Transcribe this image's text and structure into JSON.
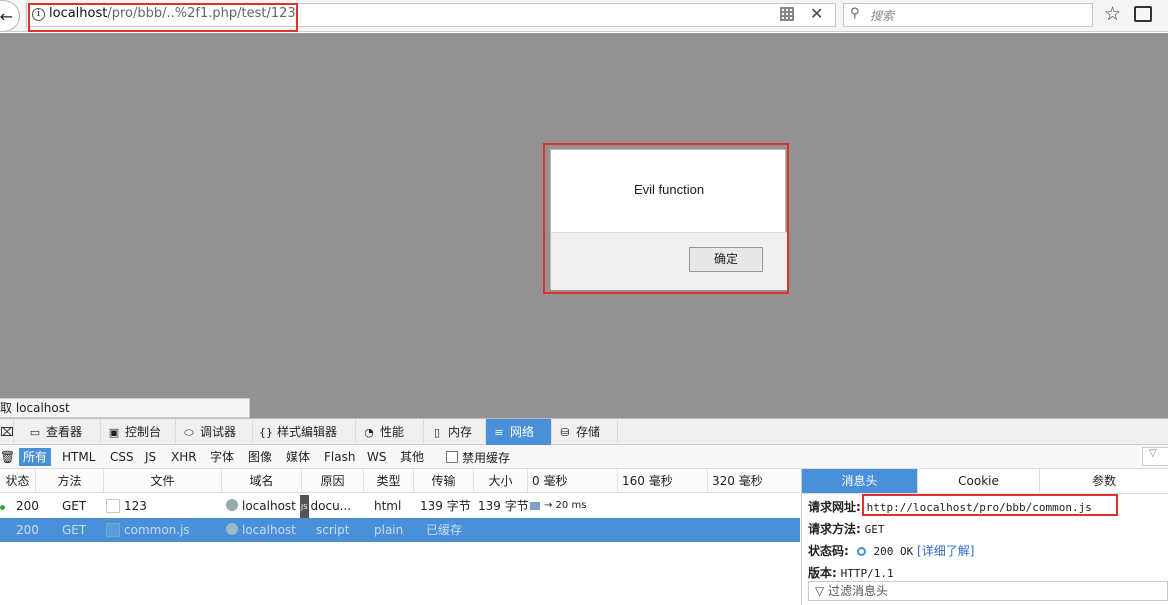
{
  "toolbar": {
    "url_host": "localhost",
    "url_path": "/pro/bbb/..%2f1.php/test/123",
    "search_placeholder": "搜索"
  },
  "dialog": {
    "message": "Evil function",
    "ok_label": "确定"
  },
  "status_tip": "取 localhost",
  "devtools": {
    "tabs": [
      "查看器",
      "控制台",
      "调试器",
      "样式编辑器",
      "性能",
      "内存",
      "网络",
      "存储"
    ],
    "selected_tab": "网络",
    "filters": [
      "所有",
      "HTML",
      "CSS",
      "JS",
      "XHR",
      "字体",
      "图像",
      "媒体",
      "Flash",
      "WS",
      "其他"
    ],
    "selected_filter": "所有",
    "disable_cache_label": "禁用缓存",
    "columns": [
      "状态",
      "方法",
      "文件",
      "域名",
      "原因",
      "类型",
      "传输",
      "大小"
    ],
    "timeline_ticks": [
      "0 毫秒",
      "160 毫秒",
      "320 毫秒"
    ],
    "requests": [
      {
        "status": "200",
        "method": "GET",
        "file": "123",
        "domain": "localhost",
        "cause": "docu...",
        "type": "html",
        "transferred": "139 字节",
        "size": "139 字节",
        "timing": "→ 20 ms"
      },
      {
        "status": "200",
        "method": "GET",
        "file": "common.js",
        "domain": "localhost",
        "cause": "script",
        "type": "plain",
        "transferred": "已缓存",
        "size": "",
        "timing": ""
      }
    ],
    "side_tabs": [
      "消息头",
      "Cookie",
      "参数"
    ],
    "selected_side_tab": "消息头",
    "details": {
      "request_url_label": "请求网址:",
      "request_url": "http://localhost/pro/bbb/common.js",
      "method_label": "请求方法:",
      "method": "GET",
      "status_label": "状态码:",
      "status": "200 OK",
      "learn_more": "[详细了解]",
      "version_label": "版本:",
      "version": "HTTP/1.1",
      "filter_headers": "过滤消息头"
    }
  },
  "colors": {
    "accent": "#4a90d9",
    "highlight": "#e03030",
    "page_bg": "#929292"
  }
}
